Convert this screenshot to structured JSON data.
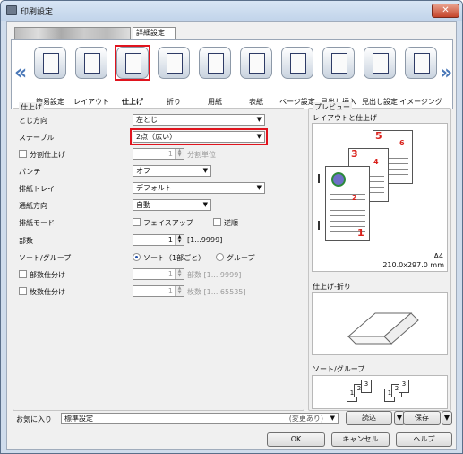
{
  "window": {
    "title": "印刷設定",
    "close": "✕"
  },
  "tabs": {
    "blurred": "",
    "detail": "詳細設定"
  },
  "toolbar": {
    "items": [
      {
        "label": "簡易設定"
      },
      {
        "label": "レイアウト"
      },
      {
        "label": "仕上げ"
      },
      {
        "label": "折り"
      },
      {
        "label": "用紙"
      },
      {
        "label": "表紙"
      },
      {
        "label": "ページ設定"
      },
      {
        "label": "見出し挿入"
      },
      {
        "label": "見出し設定"
      },
      {
        "label": "イメージング"
      }
    ],
    "left_arrow": "«",
    "right_arrow": "»"
  },
  "finishing": {
    "group_title": "仕上げ",
    "binding_label": "とじ方向",
    "binding_value": "左とじ",
    "staple_label": "ステープル",
    "staple_value": "2点（広い）",
    "split_label": "分割仕上げ",
    "split_value": "1",
    "split_unit": "分割単位",
    "punch_label": "パンチ",
    "punch_value": "オフ",
    "tray_label": "排紙トレイ",
    "tray_value": "デフォルト",
    "feed_label": "通紙方向",
    "feed_value": "自動",
    "output_label": "排紙モード",
    "faceup_label": "フェイスアップ",
    "reverse_label": "逆順",
    "copies_label": "部数",
    "copies_value": "1",
    "copies_range": "[1...9999]",
    "sort_label": "ソート/グループ",
    "sort_option": "ソート（1部ごと）",
    "group_option": "グループ",
    "set_split_label": "部数仕分け",
    "set_split_value": "1",
    "set_split_unit": "部数 [1....9999]",
    "sheet_split_label": "枚数仕分け",
    "sheet_split_value": "1",
    "sheet_split_unit": "枚数 [1....65535]"
  },
  "preview": {
    "title": "プレビュー",
    "layout_title": "レイアウトと仕上げ",
    "paper_size": "A4",
    "paper_dims": "210.0x297.0 mm",
    "fold_title": "仕上げ-折り",
    "sort_title": "ソート/グループ",
    "page_numbers": [
      "5",
      "6",
      "3",
      "4",
      "1",
      "2"
    ],
    "sort_pages": [
      "1",
      "2",
      "3",
      "1",
      "2",
      "3"
    ]
  },
  "footer": {
    "favorites_label": "お気に入り",
    "favorites_value": "標準設定",
    "changed_note": "(変更あり)",
    "load_button": "読込",
    "save_button": "保存",
    "ok_button": "OK",
    "cancel_button": "キャンセル",
    "help_button": "ヘルプ"
  },
  "colors": {
    "accent_red": "#e0141e",
    "arrow_blue": "#4a78b8",
    "title_bar": "#c2d4ea"
  }
}
